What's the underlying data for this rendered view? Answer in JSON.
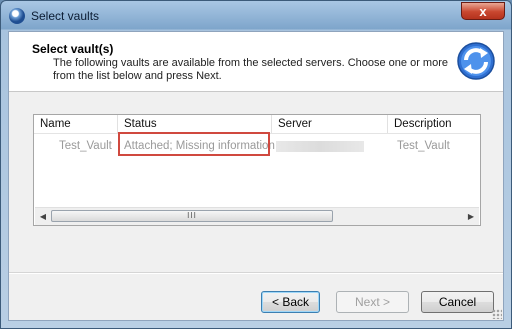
{
  "window": {
    "title": "Select vaults",
    "close_label": "x"
  },
  "header": {
    "title": "Select vault(s)",
    "description": "The following vaults are available from the selected servers. Choose one or more from the list below and press Next."
  },
  "list": {
    "columns": [
      "Name",
      "Status",
      "Server",
      "Description"
    ],
    "rows": [
      {
        "name": "Test_Vault",
        "status": "Attached; Missing information",
        "server": "",
        "description": "Test_Vault"
      }
    ],
    "scroll_grip": "III"
  },
  "buttons": {
    "back": "< Back",
    "next": "Next >",
    "cancel": "Cancel"
  },
  "colors": {
    "highlight_border": "#d0493f",
    "disabled_text": "#9a9a9a"
  }
}
